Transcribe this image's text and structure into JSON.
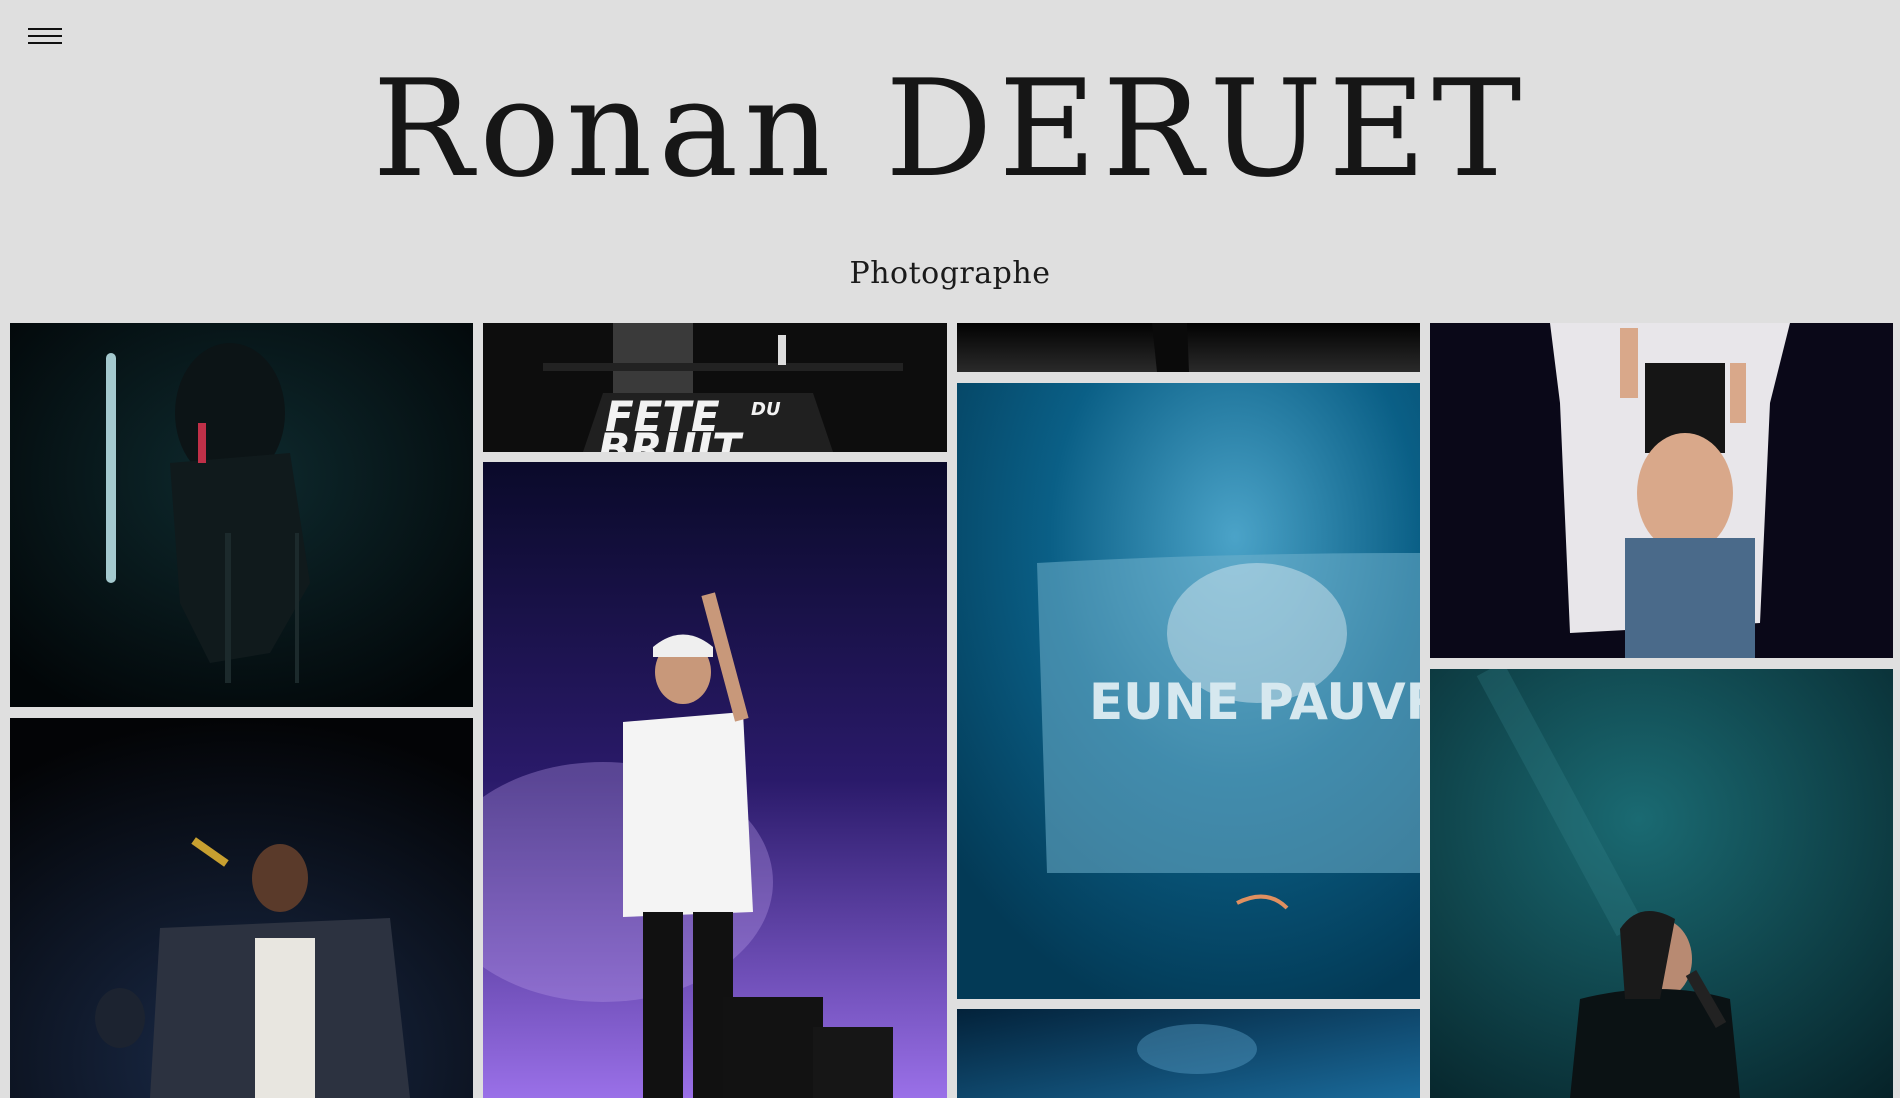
{
  "header": {
    "title": "Ronan DERUET",
    "subtitle": "Photographe",
    "menu_icon": "hamburger-menu-icon"
  },
  "gallery": {
    "photos": [
      {
        "name": "photo-rapper-seated-on-stool"
      },
      {
        "name": "photo-rapper-jacket-microphone"
      },
      {
        "name": "photo-fete-du-bruit-stage",
        "text": "FETE DU BRUIT"
      },
      {
        "name": "photo-singer-white-cap-pointing"
      },
      {
        "name": "photo-dark-stage-top"
      },
      {
        "name": "photo-banner-blue",
        "text": "EUNE PAUVR"
      },
      {
        "name": "photo-blue-stage-bottom"
      },
      {
        "name": "photo-dancer-white-shirt"
      },
      {
        "name": "photo-singer-teal-light"
      }
    ]
  },
  "colors": {
    "background": "#dfdfdf",
    "text": "#161616"
  }
}
